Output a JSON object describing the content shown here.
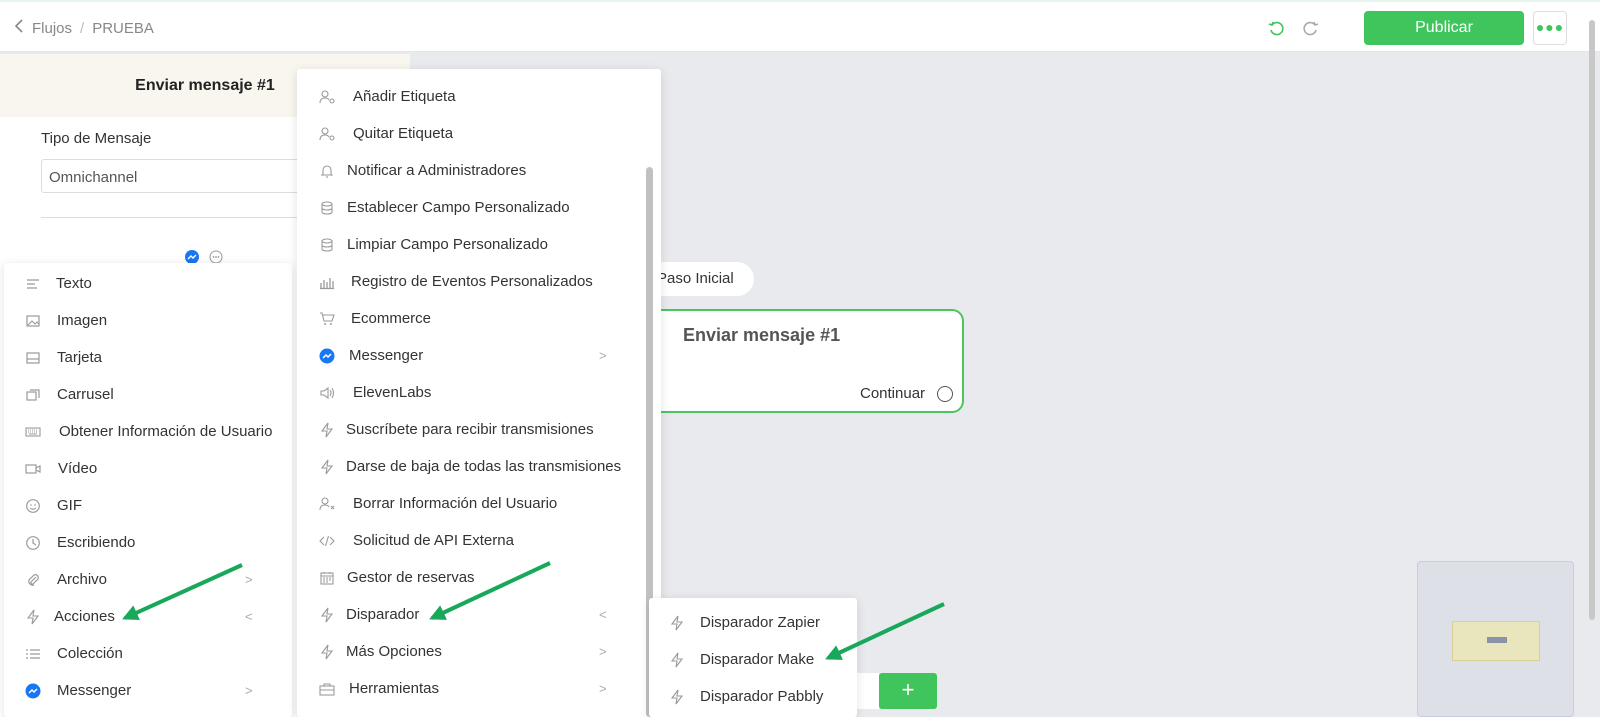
{
  "header": {
    "breadcrumb_root": "Flujos",
    "breadcrumb_sep": "/",
    "breadcrumb_current": "PRUEBA",
    "publish_label": "Publicar"
  },
  "panel": {
    "title": "Enviar mensaje #1",
    "type_label": "Tipo de Mensaje",
    "type_value": "Omnichannel"
  },
  "menu_content": [
    {
      "label": "Texto",
      "icon": "text-icon"
    },
    {
      "label": "Imagen",
      "icon": "image-icon"
    },
    {
      "label": "Tarjeta",
      "icon": "card-icon"
    },
    {
      "label": "Carrusel",
      "icon": "carousel-icon"
    },
    {
      "label": "Obtener Información de Usuario",
      "icon": "keyboard-icon"
    },
    {
      "label": "Vídeo",
      "icon": "video-icon"
    },
    {
      "label": "GIF",
      "icon": "gif-icon"
    },
    {
      "label": "Escribiendo",
      "icon": "clock-icon"
    },
    {
      "label": "Archivo",
      "icon": "paperclip-icon"
    },
    {
      "label": "Acciones",
      "icon": "bolt-icon"
    },
    {
      "label": "Colección",
      "icon": "list-icon"
    },
    {
      "label": "Messenger",
      "icon": "messenger-icon"
    }
  ],
  "menu_actions": [
    {
      "label": "Añadir Etiqueta",
      "icon": "user-tag-icon"
    },
    {
      "label": "Quitar Etiqueta",
      "icon": "user-tag-icon"
    },
    {
      "label": "Notificar a Administradores",
      "icon": "bell-icon"
    },
    {
      "label": "Establecer Campo Personalizado",
      "icon": "database-icon"
    },
    {
      "label": "Limpiar Campo Personalizado",
      "icon": "database-icon"
    },
    {
      "label": "Registro de Eventos Personalizados",
      "icon": "bar-chart-icon"
    },
    {
      "label": "Ecommerce",
      "icon": "cart-icon"
    },
    {
      "label": "Messenger",
      "icon": "messenger-icon"
    },
    {
      "label": "ElevenLabs",
      "icon": "speaker-icon"
    },
    {
      "label": "Suscríbete para recibir transmisiones",
      "icon": "bolt-icon"
    },
    {
      "label": "Darse de baja de todas las transmisiones",
      "icon": "bolt-icon"
    },
    {
      "label": "Borrar Información del Usuario",
      "icon": "user-x-icon"
    },
    {
      "label": "Solicitud de API Externa",
      "icon": "code-icon"
    },
    {
      "label": "Gestor de reservas",
      "icon": "calendar-icon"
    },
    {
      "label": "Disparador",
      "icon": "bolt-icon"
    },
    {
      "label": "Más Opciones",
      "icon": "bolt-icon"
    },
    {
      "label": "Herramientas",
      "icon": "toolbox-icon"
    }
  ],
  "menu_triggers": [
    {
      "label": "Disparador Zapier",
      "icon": "bolt-icon"
    },
    {
      "label": "Disparador Make",
      "icon": "bolt-icon"
    },
    {
      "label": "Disparador Pabbly",
      "icon": "bolt-icon"
    }
  ],
  "canvas": {
    "start_label": "Paso Inicial",
    "node_title": "Enviar mensaje #1",
    "node_continue": "Continuar",
    "add_label": "+"
  },
  "colors": {
    "accent_green": "#3fc55b",
    "annotation_arrow": "#17a85a",
    "messenger_blue": "#1877f2"
  }
}
